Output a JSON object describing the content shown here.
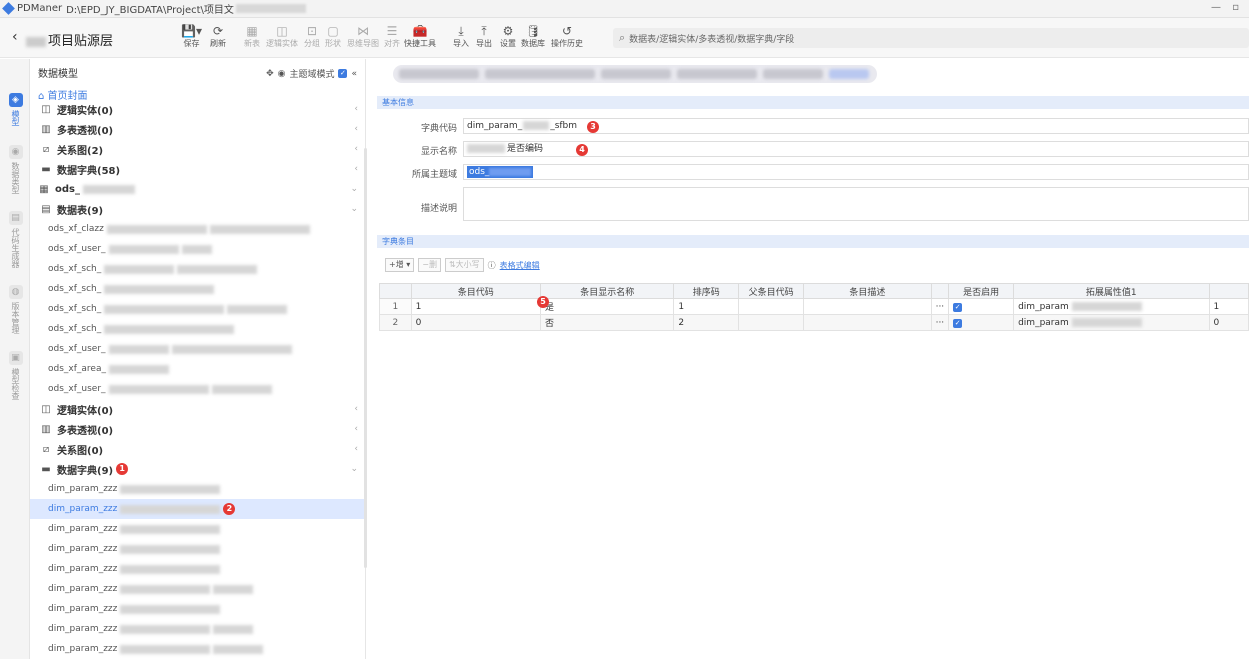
{
  "window": {
    "app": "PDManer",
    "path": "D:\\EPD_JY_BIGDATA\\Project\\项目文",
    "controls": "— ▫"
  },
  "header": {
    "back": "‹",
    "title": "项目贴源层"
  },
  "toolbar": [
    {
      "key": "save",
      "label": "保存",
      "icon": "💾▾"
    },
    {
      "key": "refresh",
      "label": "刷新",
      "icon": "⟳"
    },
    {
      "key": "new",
      "label": "新表",
      "icon": "▦"
    },
    {
      "key": "logic",
      "label": "逻辑实体",
      "icon": "◫"
    },
    {
      "key": "group",
      "label": "分组",
      "icon": "⊡"
    },
    {
      "key": "shape",
      "label": "形状",
      "icon": "▢"
    },
    {
      "key": "mindmap",
      "label": "思维导图",
      "icon": "⋈"
    },
    {
      "key": "align",
      "label": "对齐",
      "icon": "☰"
    },
    {
      "key": "quick",
      "label": "快捷工具",
      "icon": "🧰"
    },
    {
      "key": "import",
      "label": "导入",
      "icon": "⤓"
    },
    {
      "key": "export",
      "label": "导出",
      "icon": "⤒"
    },
    {
      "key": "settings",
      "label": "设置",
      "icon": "⚙"
    },
    {
      "key": "db",
      "label": "数据库",
      "icon": "🛢"
    },
    {
      "key": "history",
      "label": "操作历史",
      "icon": "↺"
    }
  ],
  "search": {
    "placeholder": "数据表/逻辑实体/多表透视/数据字典/字段"
  },
  "rail": [
    {
      "label": "模型",
      "active": true,
      "icon": "◈"
    },
    {
      "label": "数据类型",
      "active": false,
      "icon": "◉"
    },
    {
      "label": "代码生成器",
      "active": false,
      "icon": "▤"
    },
    {
      "label": "版本管理",
      "active": false,
      "icon": "◍"
    },
    {
      "label": "模型检查",
      "active": false,
      "icon": "▣"
    }
  ],
  "tree": {
    "header": "数据模型",
    "theme_mode": "主题域模式",
    "home": "首页封面",
    "group1": [
      {
        "icon": "◫",
        "label": "逻辑实体(0)"
      },
      {
        "icon": "▥",
        "label": "多表透视(0)"
      },
      {
        "icon": "⧄",
        "label": "关系图(2)"
      },
      {
        "icon": "▬",
        "label": "数据字典(58)"
      }
    ],
    "ods_label": "ods_",
    "tables_label": "数据表(9)",
    "tables": [
      "ods_xf_clazz",
      "ods_xf_user_",
      "ods_xf_sch_",
      "ods_xf_sch_",
      "ods_xf_sch_",
      "ods_xf_sch_",
      "ods_xf_user_",
      "ods_xf_area_",
      "ods_xf_user_"
    ],
    "group2": [
      {
        "icon": "◫",
        "label": "逻辑实体(0)"
      },
      {
        "icon": "▥",
        "label": "多表透视(0)"
      },
      {
        "icon": "⧄",
        "label": "关系图(0)"
      },
      {
        "icon": "▬",
        "label": "数据字典(9)"
      }
    ],
    "dicts": [
      "dim_param_zzz",
      "dim_param_zzz",
      "dim_param_zzz",
      "dim_param_zzz",
      "dim_param_zzz",
      "dim_param_zzz",
      "dim_param_zzz",
      "dim_param_zzz",
      "dim_param_zzz"
    ]
  },
  "badges": [
    "1",
    "2",
    "3",
    "4",
    "5"
  ],
  "form": {
    "section_basic": "基本信息",
    "code_label": "字典代码",
    "code_value": "dim_param_",
    "code_suffix": "_sfbm",
    "name_label": "显示名称",
    "name_value": "是否编码",
    "domain_label": "所属主题域",
    "domain_value": "ods_",
    "desc_label": "描述说明"
  },
  "items": {
    "section": "字典条目",
    "add": "+增 ▾",
    "del": "−删",
    "sort": "⇅大小写",
    "info": "ⓘ",
    "edit": "表格式编辑",
    "columns": [
      "",
      "条目代码",
      "条目显示名称",
      "排序码",
      "父条目代码",
      "条目描述",
      "",
      "是否启用",
      "拓展属性值1",
      ""
    ],
    "rows": [
      {
        "n": "1",
        "code": "1",
        "name": "是",
        "sort": "1",
        "parent": "",
        "desc": "",
        "more": "···",
        "enabled": "✓",
        "ext1": "dim_param",
        "ext2": "1"
      },
      {
        "n": "2",
        "code": "0",
        "name": "否",
        "sort": "2",
        "parent": "",
        "desc": "",
        "more": "···",
        "enabled": "✓",
        "ext1": "dim_param",
        "ext2": "0"
      }
    ]
  }
}
